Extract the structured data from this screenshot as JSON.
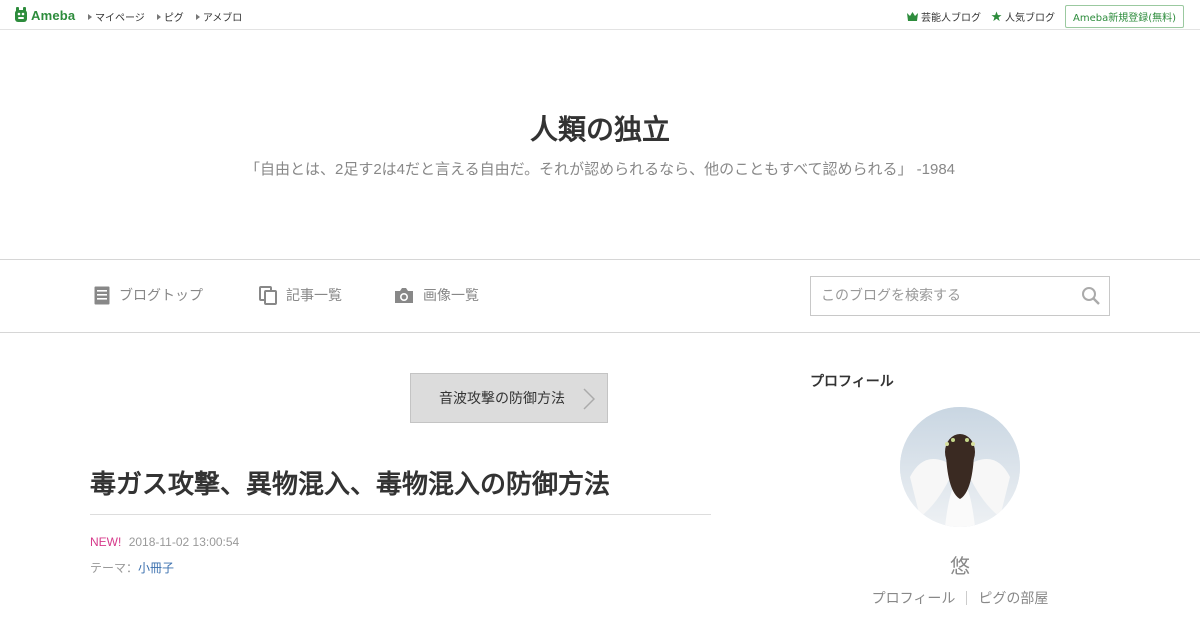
{
  "topbar": {
    "logo": "Ameba",
    "links": [
      "マイページ",
      "ピグ",
      "アメブロ"
    ],
    "celebrity_blog": "芸能人ブログ",
    "popular_blog": "人気ブログ",
    "register": "Ameba新規登録(無料)",
    "brand_color": "#2d8c3c"
  },
  "header": {
    "title": "人類の独立",
    "description": "「自由とは、2足す2は4だと言える自由だ。それが認められるなら、他のこともすべて認められる」 -1984"
  },
  "nav": {
    "items": [
      {
        "label": "ブログトップ",
        "icon": "document-icon"
      },
      {
        "label": "記事一覧",
        "icon": "copy-icon"
      },
      {
        "label": "画像一覧",
        "icon": "camera-icon"
      }
    ],
    "search_placeholder": "このブログを検索する"
  },
  "article": {
    "prev_link": "音波攻撃の防御方法",
    "title": "毒ガス攻撃、異物混入、毒物混入の防御方法",
    "new_label": "NEW!",
    "datetime": "2018-11-02 13:00:54",
    "theme_label": "テーマ：",
    "theme": "小冊子"
  },
  "sidebar": {
    "heading": "プロフィール",
    "nickname": "悠",
    "links": [
      "プロフィール",
      "ピグの部屋"
    ]
  }
}
